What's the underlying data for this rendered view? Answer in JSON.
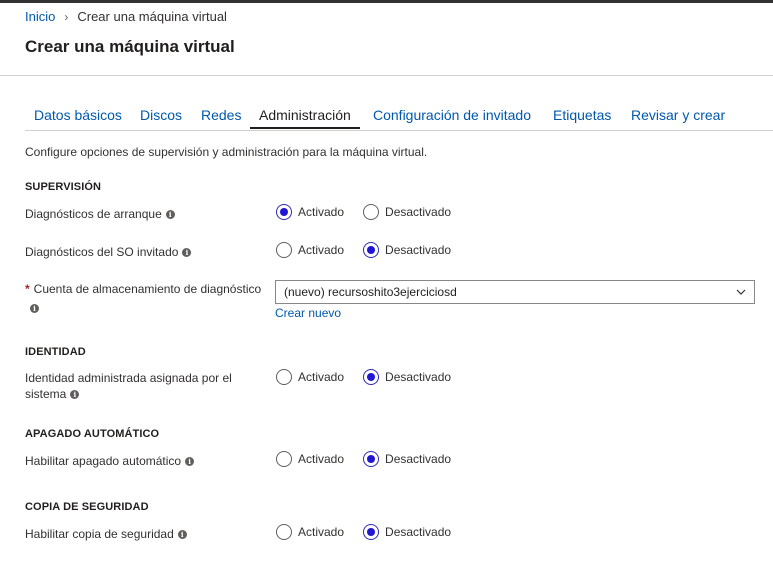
{
  "breadcrumb": {
    "home": "Inicio",
    "current": "Crear una máquina virtual",
    "separator": "›"
  },
  "page": {
    "title": "Crear una máquina virtual"
  },
  "tabs": [
    {
      "label": "Datos básicos"
    },
    {
      "label": "Discos"
    },
    {
      "label": "Redes"
    },
    {
      "label": "Administración",
      "active": true
    },
    {
      "label": "Configuración de invitado"
    },
    {
      "label": "Etiquetas"
    },
    {
      "label": "Revisar y crear"
    }
  ],
  "description": "Configure opciones de supervisión y administración para la máquina virtual.",
  "options": {
    "on": "Activado",
    "off": "Desactivado"
  },
  "sections": {
    "supervision": {
      "title": "SUPERVISIÓN",
      "boot_diag": {
        "label": "Diagnósticos de arranque",
        "value": "Activado"
      },
      "guest_diag": {
        "label": "Diagnósticos del SO invitado",
        "value": "Desactivado"
      },
      "storage": {
        "required_mark": "*",
        "label": "Cuenta de almacenamiento de diagnóstico",
        "value": "(nuevo) recursoshito3ejerciciosd",
        "create_link": "Crear nuevo"
      }
    },
    "identity": {
      "title": "IDENTIDAD",
      "managed_identity": {
        "label_line1": "Identidad administrada asignada por el",
        "label_line2": "sistema",
        "value": "Desactivado"
      }
    },
    "auto_shutdown": {
      "title": "APAGADO AUTOMÁTICO",
      "enable": {
        "label": "Habilitar apagado automático",
        "value": "Desactivado"
      }
    },
    "backup": {
      "title": "COPIA DE SEGURIDAD",
      "enable": {
        "label": "Habilitar copia de seguridad",
        "value": "Desactivado"
      }
    }
  },
  "colors": {
    "link": "#0058ad",
    "radio_selected": "#2016d4",
    "required": "#a4262c"
  },
  "icons": {
    "info": "info-icon",
    "chevron": "chevron-down-icon",
    "breadcrumb_sep": "chevron-right-icon"
  }
}
